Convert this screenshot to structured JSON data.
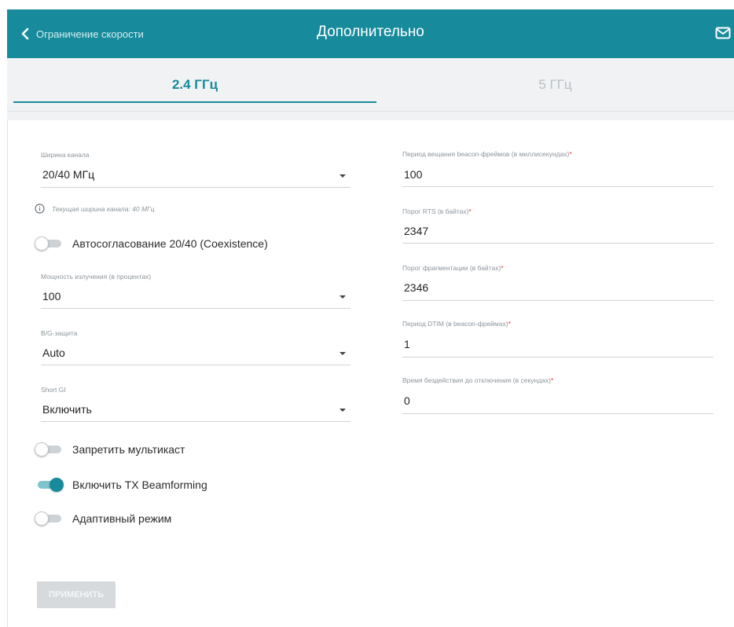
{
  "header": {
    "back_label": "Ограничение скорости",
    "title": "Дополнительно",
    "back_icon": "chevron-left-icon",
    "mail_icon": "mail-icon"
  },
  "tabs": [
    {
      "label": "2.4 ГГц",
      "active": true
    },
    {
      "label": "5 ГГц",
      "active": false
    }
  ],
  "left": {
    "channel_width": {
      "label": "Ширина канала",
      "value": "20/40 МГц"
    },
    "current_width_info": "Текущая ширина канала: 40 МГц",
    "coexistence": {
      "label": "Автосогласование 20/40 (Coexistence)",
      "on": false
    },
    "tx_power": {
      "label": "Мощность излучения (в процентах)",
      "value": "100"
    },
    "bg_protection": {
      "label": "B/G-защита",
      "value": "Auto"
    },
    "short_gi": {
      "label": "Short GI",
      "value": "Включить"
    },
    "block_multicast": {
      "label": "Запретить мультикаст",
      "on": false
    },
    "tx_beamforming": {
      "label": "Включить TX Beamforming",
      "on": true
    },
    "adaptive_mode": {
      "label": "Адаптивный режим",
      "on": false
    }
  },
  "right": {
    "beacon_period": {
      "label": "Период вещания beacon-фреймов (в миллисекундах)",
      "value": "100"
    },
    "rts_threshold": {
      "label": "Порог RTS (в байтах)",
      "value": "2347"
    },
    "frag_threshold": {
      "label": "Порог фрагментации (в байтах)",
      "value": "2346"
    },
    "dtim_period": {
      "label": "Период DTIM (в beacon-фреймах)",
      "value": "1"
    },
    "idle_timeout": {
      "label": "Время бездействия до отключения (в секундах)",
      "value": "0"
    }
  },
  "apply_label": "ПРИМЕНИТЬ",
  "colors": {
    "accent": "#178b9c",
    "required": "#e23b3b"
  }
}
